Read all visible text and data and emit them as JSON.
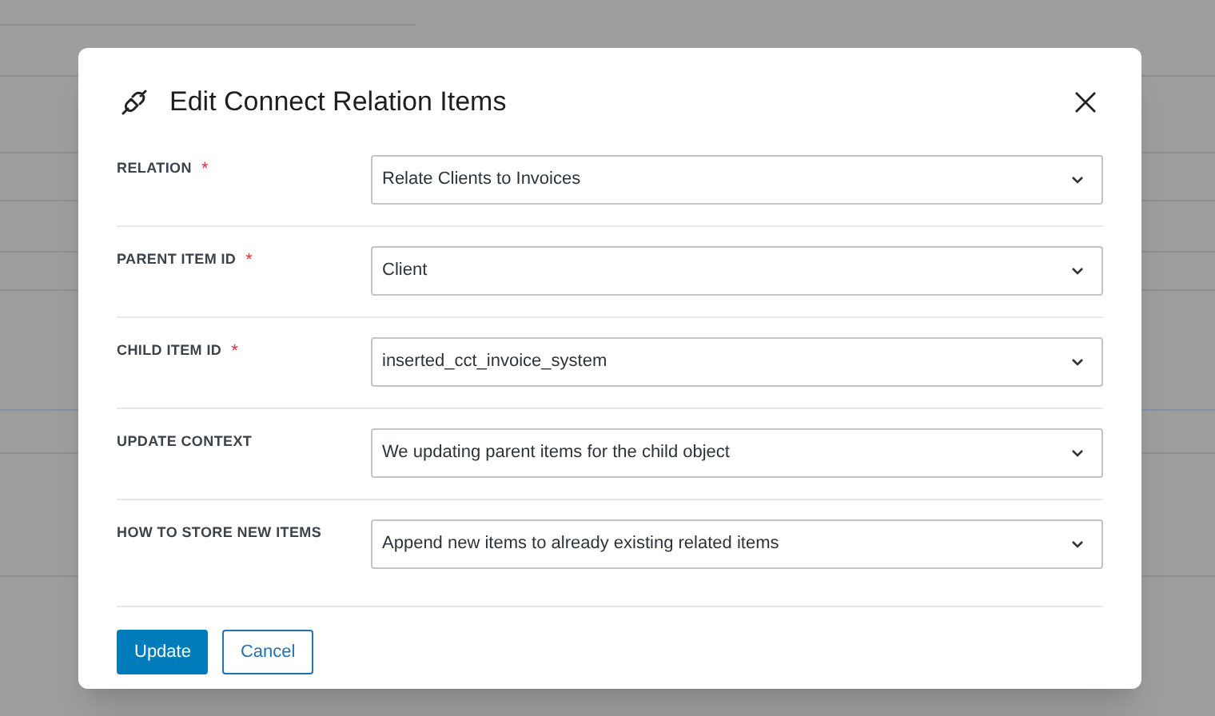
{
  "dialog": {
    "title": "Edit Connect Relation Items"
  },
  "fields": [
    {
      "label": "RELATION",
      "required_mark": "*",
      "value": "Relate Clients to Invoices"
    },
    {
      "label": "PARENT ITEM ID",
      "required_mark": "*",
      "value": "Client"
    },
    {
      "label": "CHILD ITEM ID",
      "required_mark": "*",
      "value": "inserted_cct_invoice_system"
    },
    {
      "label": "UPDATE CONTEXT",
      "value": "We updating parent items for the child object"
    },
    {
      "label": "HOW TO STORE NEW ITEMS",
      "value": "Append new items to already existing related items"
    }
  ],
  "buttons": [
    {
      "label": "Update",
      "kind": "primary"
    },
    {
      "label": "Cancel",
      "kind": "secondary"
    }
  ]
}
